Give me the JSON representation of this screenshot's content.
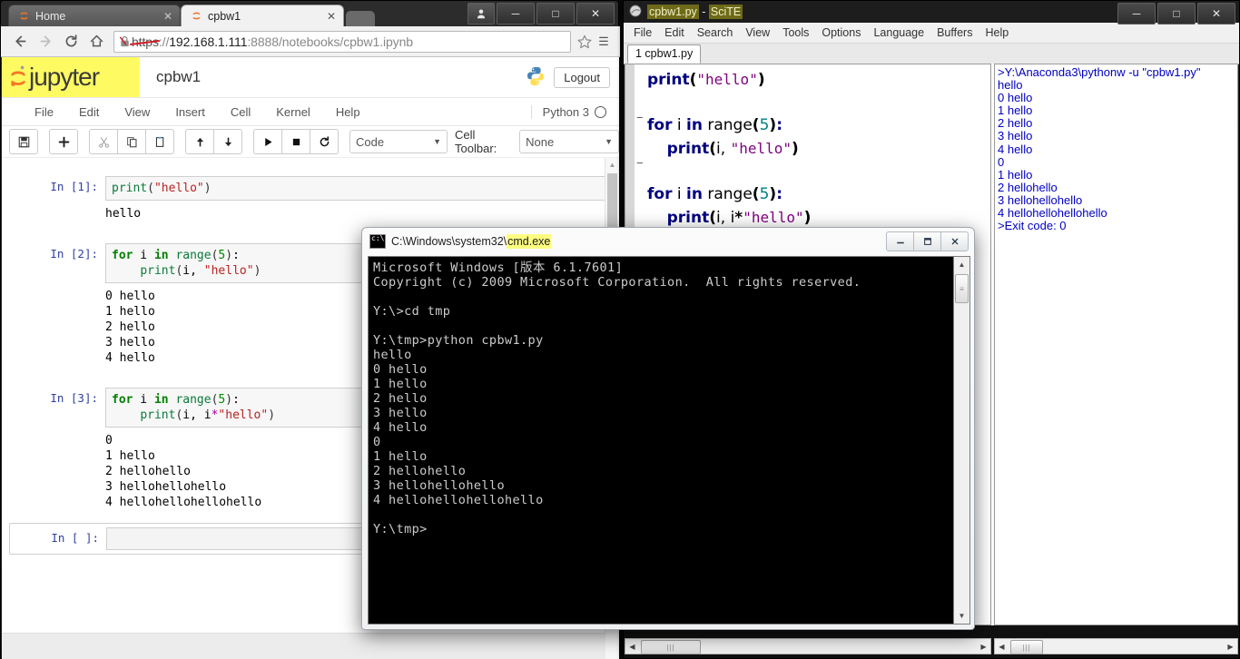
{
  "browser": {
    "tabs": [
      {
        "label": "Home",
        "active": false,
        "close": "✕"
      },
      {
        "label": "cpbw1",
        "active": true,
        "close": "✕"
      }
    ],
    "window_buttons": {
      "user": "user-icon",
      "minimize": "─",
      "maximize": "□",
      "close": "✕"
    },
    "nav": {
      "back": "←",
      "forward": "→",
      "reload": "C",
      "home": "home-icon"
    },
    "url": {
      "scheme_crossed": "https",
      "scheme_rest": "://",
      "host": "192.168.1.111",
      "port": ":8888",
      "path": "/notebooks/cpbw1.ipynb",
      "full": "https://192.168.1.111:8888/notebooks/cpbw1.ipynb",
      "security": "not-secure-crossed-lock"
    },
    "bookmark_star": "☆",
    "menu": "☰"
  },
  "jupyter": {
    "logo_word": "jupyter",
    "logo_bg": "#fefb62",
    "notebook_name": "cpbw1",
    "logout_label": "Logout",
    "kernel_label": "Python 3",
    "menu_items": [
      "File",
      "Edit",
      "View",
      "Insert",
      "Cell",
      "Kernel",
      "Help"
    ],
    "toolbar": {
      "buttons": [
        "save-icon",
        "add-icon",
        "cut-icon",
        "copy-icon",
        "paste-icon",
        "move-up-icon",
        "move-down-icon",
        "run-icon",
        "stop-icon",
        "restart-icon"
      ],
      "cell_type_value": "Code",
      "cell_toolbar_label": "Cell Toolbar:",
      "cell_toolbar_value": "None"
    },
    "cells": [
      {
        "prompt": "In [1]:",
        "code_plain": "print(\"hello\")",
        "output": "hello"
      },
      {
        "prompt": "In [2]:",
        "code_plain": "for i in range(5):\n    print(i, \"hello\")",
        "output": "0 hello\n1 hello\n2 hello\n3 hello\n4 hello"
      },
      {
        "prompt": "In [3]:",
        "code_plain": "for i in range(5):\n    print(i, i*\"hello\")",
        "output": "0\n1 hello\n2 hellohello\n3 hellohellohello\n4 hellohellohellohello"
      },
      {
        "prompt": "In [ ]:",
        "code_plain": "",
        "output": ""
      }
    ]
  },
  "scite": {
    "title_file": "cpbw1.py",
    "title_sep": " - ",
    "title_app": "SciTE",
    "menu_items": [
      "File",
      "Edit",
      "Search",
      "View",
      "Tools",
      "Options",
      "Language",
      "Buffers",
      "Help"
    ],
    "tab_label": "1 cpbw1.py",
    "editor_code": "print(\"hello\")\n\nfor i in range(5):\n    print(i, \"hello\")\n\nfor i in range(5):\n    print(i, i*\"hello\")",
    "output_text": ">Y:\\Anaconda3\\pythonw -u \"cpbw1.py\"\nhello\n0 hello\n1 hello\n2 hello\n3 hello\n4 hello\n0\n1 hello\n2 hellohello\n3 hellohellohello\n4 hellohellohellohello\n>Exit code: 0",
    "window_buttons": {
      "minimize": "─",
      "maximize": "□",
      "close": "✕"
    }
  },
  "cmd": {
    "title_path": "C:\\Windows\\system32\\",
    "title_exe": "cmd.exe",
    "title_full": "C:\\Windows\\system32\\cmd.exe",
    "window_buttons": {
      "minimize": "─",
      "maximize": "□",
      "close": "✕"
    },
    "console_text": "Microsoft Windows [版本 6.1.7601]\nCopyright (c) 2009 Microsoft Corporation.  All rights reserved.\n\nY:\\>cd tmp\n\nY:\\tmp>python cpbw1.py\nhello\n0 hello\n1 hello\n2 hello\n3 hello\n4 hello\n0\n1 hello\n2 hellohello\n3 hellohellohello\n4 hellohellohellohello\n\nY:\\tmp>"
  },
  "colors": {
    "jupyter_yellow": "#fefb62",
    "prompt_blue": "#303f9f",
    "string_red": "#ba2121",
    "keyword_green": "#008000",
    "scite_output_blue": "#0000c0",
    "console_grey": "#cccccc"
  }
}
